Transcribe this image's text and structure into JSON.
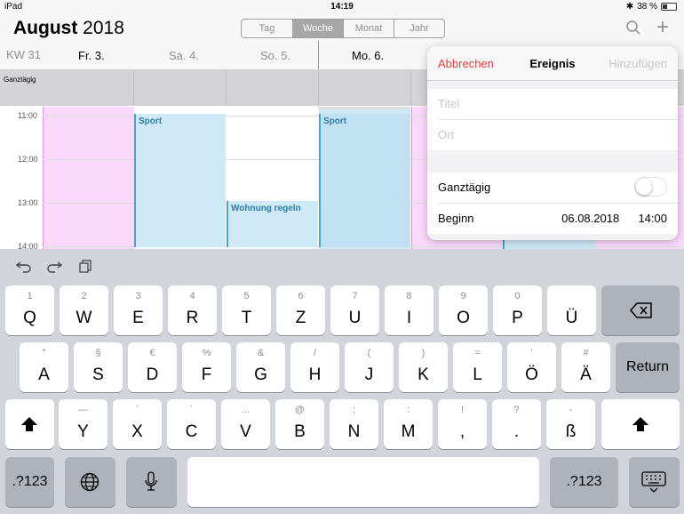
{
  "status": {
    "device": "iPad",
    "time": "14:19",
    "battery": "38 %",
    "battery_level": 0.38
  },
  "header": {
    "month": "August",
    "year": "2018",
    "views": [
      "Tag",
      "Woche",
      "Monat",
      "Jahr"
    ],
    "selected_view": "Woche"
  },
  "dayrow": {
    "week": "KW 31",
    "days": [
      "Fr. 3.",
      "Sa. 4.",
      "So. 5.",
      "Mo. 6."
    ]
  },
  "allday": {
    "label": "Ganztägig"
  },
  "grid": {
    "times": [
      "11:00",
      "12:00",
      "13:00",
      "14:00"
    ]
  },
  "events": {
    "sport_sat": "Sport",
    "wohnung": "Wohnung regeln",
    "sport_mon": "Sport"
  },
  "popover": {
    "cancel": "Abbrechen",
    "title": "Ereignis",
    "add": "Hinzufügen",
    "title_placeholder": "Titel",
    "location_placeholder": "Ort",
    "allday_label": "Ganztägig",
    "allday_on": false,
    "start_label": "Beginn",
    "start_date": "06.08.2018",
    "start_time": "14:00"
  },
  "keyboard": {
    "row1": [
      {
        "sub": "1",
        "main": "Q"
      },
      {
        "sub": "2",
        "main": "W"
      },
      {
        "sub": "3",
        "main": "E"
      },
      {
        "sub": "4",
        "main": "R"
      },
      {
        "sub": "5",
        "main": "T"
      },
      {
        "sub": "6",
        "main": "Z"
      },
      {
        "sub": "7",
        "main": "U"
      },
      {
        "sub": "8",
        "main": "I"
      },
      {
        "sub": "9",
        "main": "O"
      },
      {
        "sub": "0",
        "main": "P"
      },
      {
        "sub": "",
        "main": "Ü"
      }
    ],
    "row2": [
      {
        "sub": "\"",
        "main": "A"
      },
      {
        "sub": "§",
        "main": "S"
      },
      {
        "sub": "€",
        "main": "D"
      },
      {
        "sub": "%",
        "main": "F"
      },
      {
        "sub": "&",
        "main": "G"
      },
      {
        "sub": "/",
        "main": "H"
      },
      {
        "sub": "(",
        "main": "J"
      },
      {
        "sub": ")",
        "main": "K"
      },
      {
        "sub": "=",
        "main": "L"
      },
      {
        "sub": "’",
        "main": "Ö"
      },
      {
        "sub": "#",
        "main": "Ä"
      }
    ],
    "row3": [
      {
        "sub": "—",
        "main": "Y"
      },
      {
        "sub": "`",
        "main": "X"
      },
      {
        "sub": "´",
        "main": "C"
      },
      {
        "sub": "...",
        "main": "V"
      },
      {
        "sub": "@",
        "main": "B"
      },
      {
        "sub": ";",
        "main": "N"
      },
      {
        "sub": ":",
        "main": "M"
      },
      {
        "sub": "!",
        "main": ","
      },
      {
        "sub": "?",
        "main": "."
      },
      {
        "sub": "-",
        "main": "ß"
      }
    ],
    "return": "Return",
    "numbers": ".?123",
    "numbers_right": ".?123"
  }
}
